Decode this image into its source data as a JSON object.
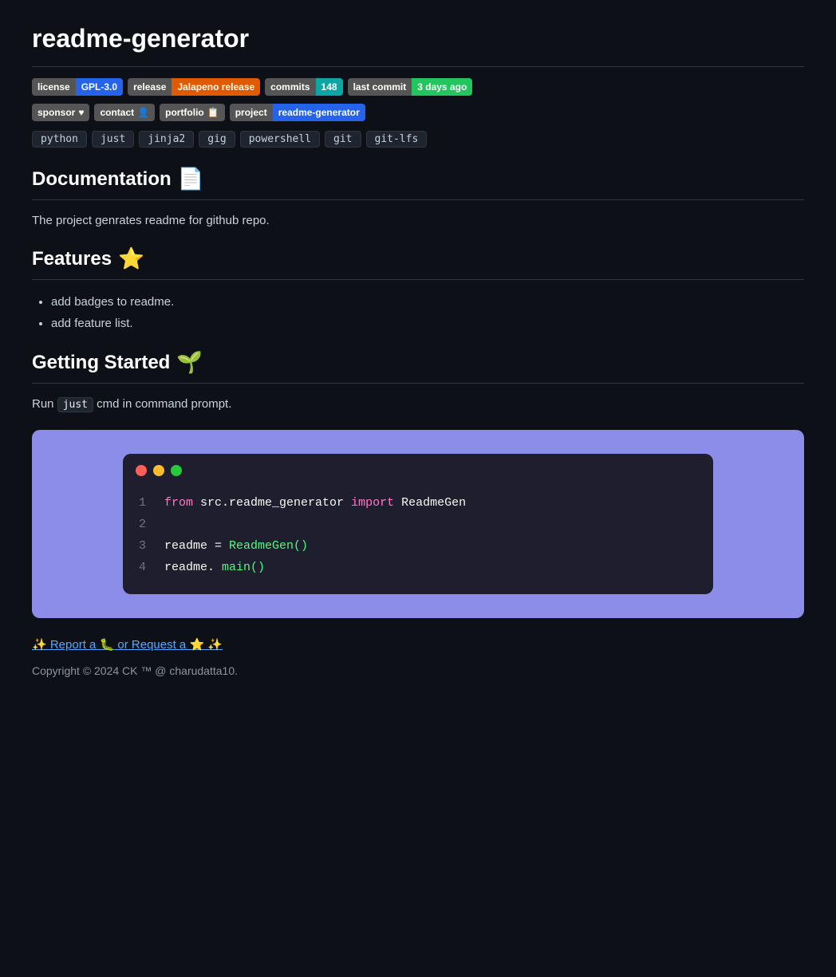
{
  "page": {
    "title": "readme-generator"
  },
  "badges": [
    {
      "label": "license",
      "value": "GPL-3.0",
      "valueColor": "blue"
    },
    {
      "label": "release",
      "value": "Jalapeno release",
      "valueColor": "orange"
    },
    {
      "label": "commits",
      "value": "148",
      "valueColor": "teal"
    },
    {
      "label": "last commit",
      "value": "3 days ago",
      "valueColor": "green"
    }
  ],
  "linkBadges": [
    {
      "label": "sponsor",
      "labelIcon": "♥",
      "value": "",
      "valueColor": "pink"
    },
    {
      "label": "contact",
      "labelIcon": "👤",
      "value": "",
      "valueColor": "blue"
    },
    {
      "label": "portfolio",
      "labelIcon": "📋",
      "value": "",
      "valueColor": "teal"
    },
    {
      "label": "project",
      "value": "readme-generator",
      "valueColor": "blue"
    }
  ],
  "tags": [
    "python",
    "just",
    "jinja2",
    "gig",
    "powershell",
    "git",
    "git-lfs"
  ],
  "documentation": {
    "heading": "Documentation",
    "emoji": "📄",
    "body": "The project genrates readme for github repo."
  },
  "features": {
    "heading": "Features",
    "emoji": "⭐",
    "items": [
      "add badges to readme.",
      "add feature list."
    ]
  },
  "gettingStarted": {
    "heading": "Getting Started",
    "emoji": "🌱",
    "preText": "Run",
    "inlineCode": "just",
    "postText": "cmd in command prompt."
  },
  "codeBlock": {
    "lines": [
      {
        "num": "1",
        "code": [
          {
            "text": "from",
            "class": "kw-from"
          },
          {
            "text": " src.readme_generator ",
            "class": "kw-plain"
          },
          {
            "text": "import",
            "class": "kw-import"
          },
          {
            "text": " ReadmeGen",
            "class": "kw-plain"
          }
        ]
      },
      {
        "num": "2",
        "code": []
      },
      {
        "num": "3",
        "code": [
          {
            "text": "readme ",
            "class": "kw-plain"
          },
          {
            "text": "= ",
            "class": "kw-plain"
          },
          {
            "text": "ReadmeGen()",
            "class": "kw-func"
          }
        ]
      },
      {
        "num": "4",
        "code": [
          {
            "text": "readme.",
            "class": "kw-plain"
          },
          {
            "text": "main()",
            "class": "kw-func"
          }
        ]
      }
    ]
  },
  "footer": {
    "linkText": "✨ Report a 🐛 or Request a ⭐ ✨",
    "copyright": "Copyright © 2024 CK ™ @ charudatta10."
  }
}
